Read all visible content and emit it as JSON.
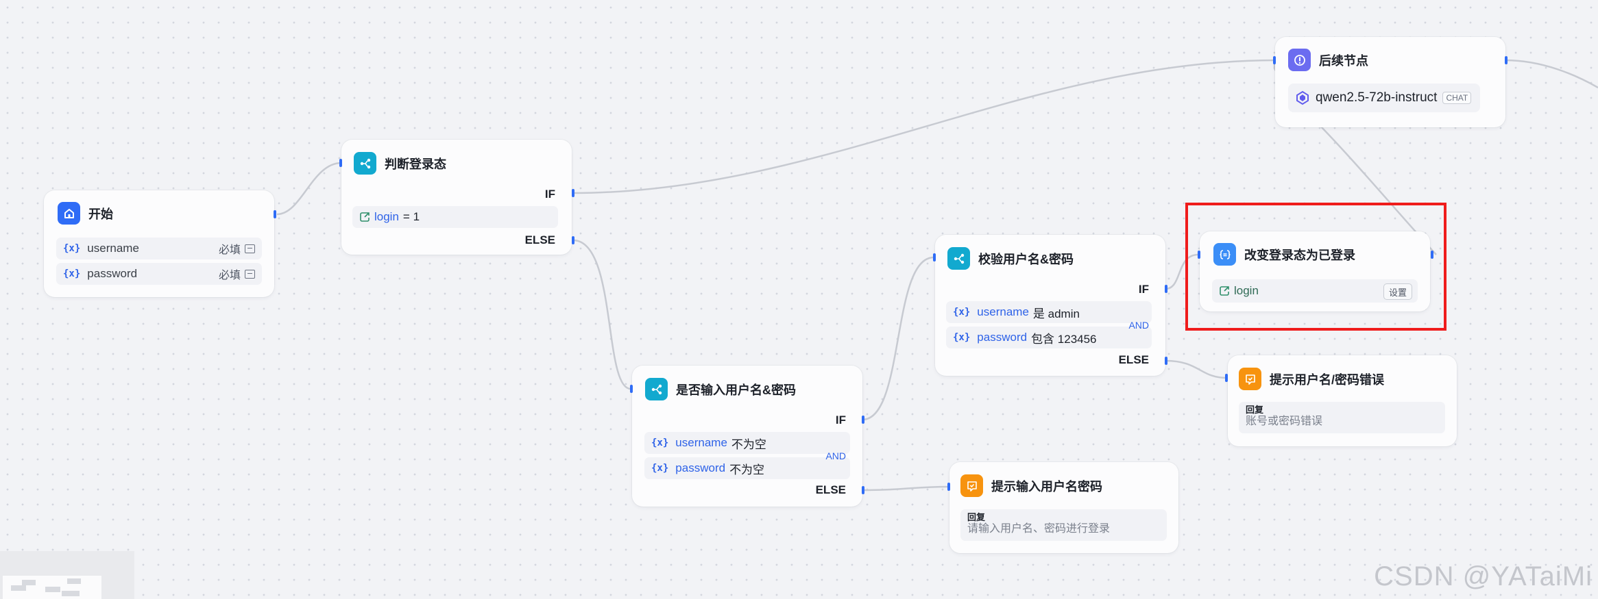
{
  "nodes": {
    "start": {
      "title": "开始",
      "vars": [
        {
          "name": "username",
          "required": "必填"
        },
        {
          "name": "password",
          "required": "必填"
        }
      ]
    },
    "judge_login": {
      "title": "判断登录态",
      "if_label": "IF",
      "condition_var": "login",
      "condition_op": "= 1",
      "else_label": "ELSE"
    },
    "followup": {
      "title": "后续节点",
      "model": "qwen2.5-72b-instruct",
      "model_tag": "CHAT"
    },
    "input_check": {
      "title": "是否输入用户名&密码",
      "if_label": "IF",
      "conditions": [
        {
          "var": "username",
          "op": "不为空"
        },
        {
          "var": "password",
          "op": "不为空"
        }
      ],
      "logic": "AND",
      "else_label": "ELSE"
    },
    "verify": {
      "title": "校验用户名&密码",
      "if_label": "IF",
      "conditions": [
        {
          "var": "username",
          "op": "是 admin"
        },
        {
          "var": "password",
          "op": "包含 123456"
        }
      ],
      "logic": "AND",
      "else_label": "ELSE"
    },
    "set_login": {
      "title": "改变登录态为已登录",
      "var": "login",
      "button": "设置"
    },
    "error_reply": {
      "title": "提示用户名/密码错误",
      "reply_label": "回复",
      "reply_text": "账号或密码错误"
    },
    "prompt_reply": {
      "title": "提示输入用户名密码",
      "reply_label": "回复",
      "reply_text": "请输入用户名、密码进行登录"
    }
  },
  "icons": {
    "var": "{x}",
    "start": "home-icon",
    "condition": "branch-icon",
    "followup": "info-icon",
    "model": "model-logo-icon",
    "reply": "reply-icon",
    "set_var": "variable-icon",
    "login_var": "login-var-icon"
  },
  "colors": {
    "accent": "#2f6cf6",
    "condition": "#12a9cf",
    "reply": "#f7930f",
    "highlight": "#ef1c1c"
  },
  "watermark": "CSDN @YATaiMi"
}
